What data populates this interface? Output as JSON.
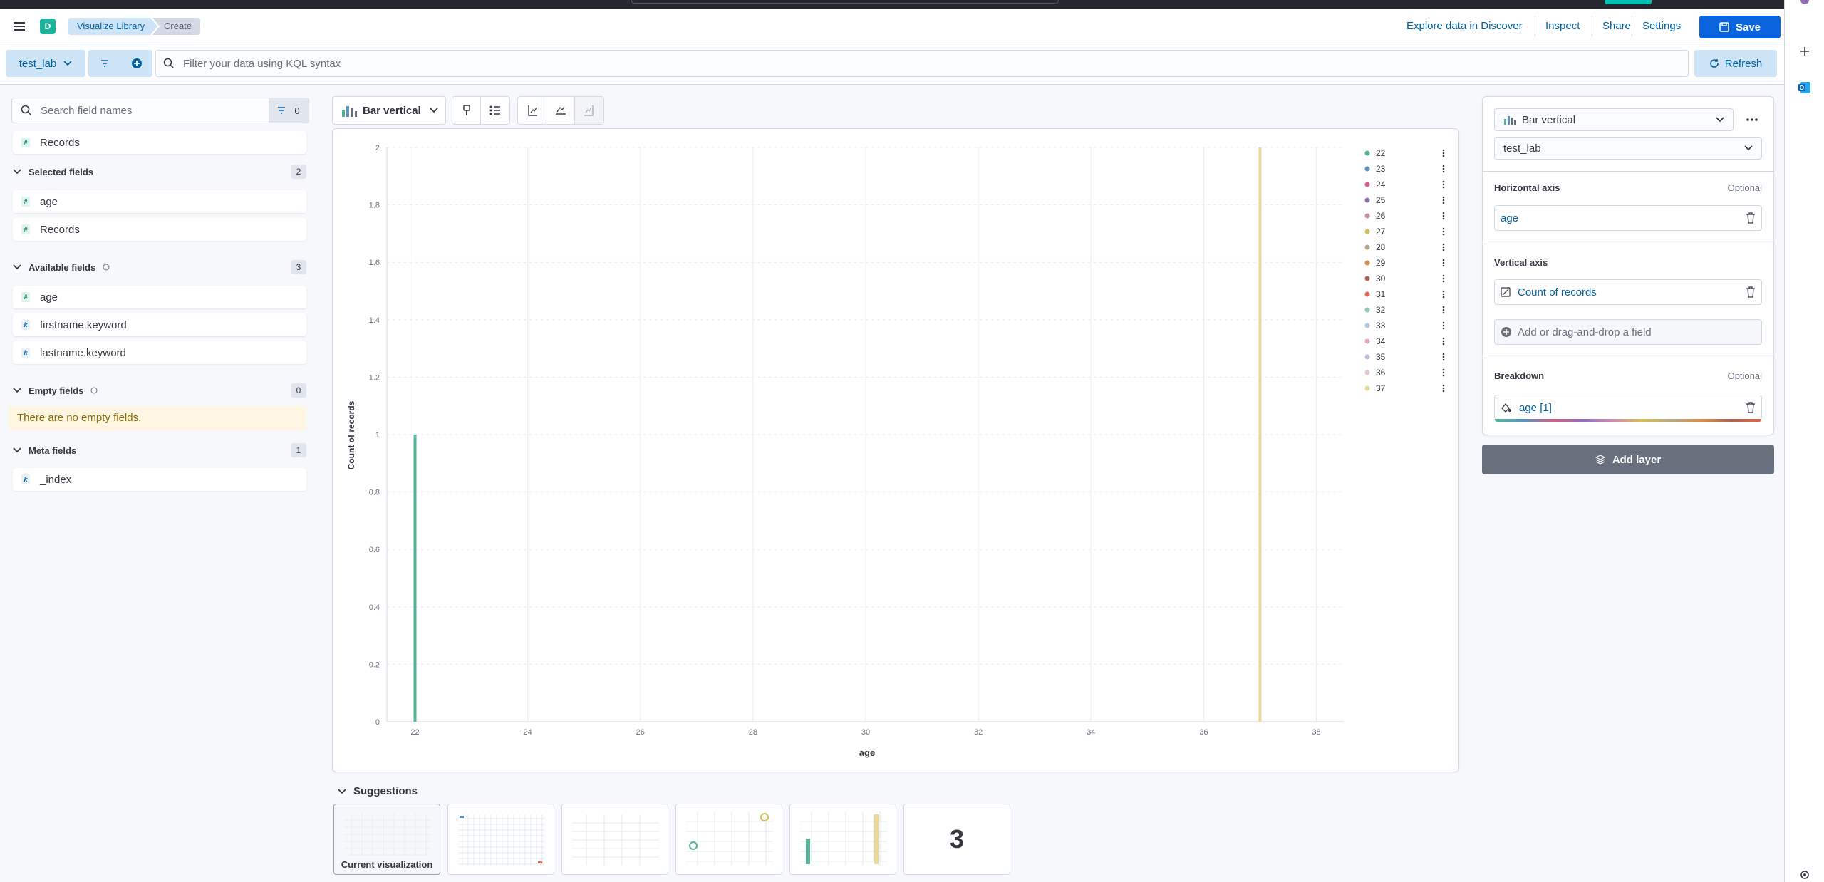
{
  "colors": {
    "accent": "#0b64dd",
    "link": "#0061a6",
    "badge": "#1bb39c",
    "bar_22": "#54b399",
    "bar_37": "#ecd998"
  },
  "header": {
    "space_initial": "D",
    "breadcrumbs": [
      "Visualize Library",
      "Create"
    ],
    "links": [
      "Explore data in Discover",
      "Inspect",
      "Share",
      "Settings"
    ],
    "save_label": "Save"
  },
  "query": {
    "data_view": "test_lab",
    "placeholder": "Filter your data using KQL syntax",
    "refresh_label": "Refresh"
  },
  "field_list": {
    "search_placeholder": "Search field names",
    "filter_count": "0",
    "records_item": "Records",
    "sections": [
      {
        "title": "Selected fields",
        "count": "2",
        "items": [
          {
            "name": "age",
            "type": "number"
          },
          {
            "name": "Records",
            "type": "number"
          }
        ]
      },
      {
        "title": "Available fields",
        "count": "3",
        "items": [
          {
            "name": "age",
            "type": "number"
          },
          {
            "name": "firstname.keyword",
            "type": "keyword"
          },
          {
            "name": "lastname.keyword",
            "type": "keyword"
          }
        ]
      },
      {
        "title": "Empty fields",
        "count": "0",
        "empty_message": "There are no empty fields."
      },
      {
        "title": "Meta fields",
        "count": "1",
        "items": [
          {
            "name": "_index",
            "type": "keyword"
          }
        ]
      }
    ]
  },
  "toolbar": {
    "chart_type": "Bar vertical"
  },
  "chart_data": {
    "type": "bar",
    "xlabel": "age",
    "ylabel": "Count of records",
    "xlim": [
      21.5,
      38.5
    ],
    "ylim": [
      0,
      2
    ],
    "x_ticks": [
      "22",
      "24",
      "26",
      "28",
      "30",
      "32",
      "34",
      "36",
      "38"
    ],
    "y_ticks": [
      "0",
      "0.2",
      "0.4",
      "0.6",
      "0.8",
      "1",
      "1.2",
      "1.4",
      "1.6",
      "1.8",
      "2"
    ],
    "grid": true,
    "legend_position": "right",
    "series": [
      {
        "name": "22",
        "color": "#54b399",
        "x": 22,
        "y": 1
      },
      {
        "name": "23",
        "color": "#6092c0",
        "x": 23,
        "y": 0
      },
      {
        "name": "24",
        "color": "#d36086",
        "x": 24,
        "y": 0
      },
      {
        "name": "25",
        "color": "#9170b8",
        "x": 25,
        "y": 0
      },
      {
        "name": "26",
        "color": "#ca8eae",
        "x": 26,
        "y": 0
      },
      {
        "name": "27",
        "color": "#d6bf57",
        "x": 27,
        "y": 0
      },
      {
        "name": "28",
        "color": "#b9a888",
        "x": 28,
        "y": 0
      },
      {
        "name": "29",
        "color": "#da8b45",
        "x": 29,
        "y": 0
      },
      {
        "name": "30",
        "color": "#aa6556",
        "x": 30,
        "y": 0
      },
      {
        "name": "31",
        "color": "#e7664c",
        "x": 31,
        "y": 0
      },
      {
        "name": "32",
        "color": "#98c8b8",
        "x": 32,
        "y": 0
      },
      {
        "name": "33",
        "color": "#b0c9e0",
        "x": 33,
        "y": 0
      },
      {
        "name": "34",
        "color": "#e4a6c7",
        "x": 34,
        "y": 0
      },
      {
        "name": "35",
        "color": "#c9b8dc",
        "x": 35,
        "y": 0
      },
      {
        "name": "36",
        "color": "#e4c4d8",
        "x": 36,
        "y": 0
      },
      {
        "name": "37",
        "color": "#ecd998",
        "x": 37,
        "y": 2
      }
    ]
  },
  "config": {
    "chart_type": "Bar vertical",
    "data_view": "test_lab",
    "horizontal_axis": {
      "title": "Horizontal axis",
      "optional": "Optional",
      "field": "age"
    },
    "vertical_axis": {
      "title": "Vertical axis",
      "field": "Count of records",
      "add_field": "Add or drag-and-drop a field"
    },
    "breakdown": {
      "title": "Breakdown",
      "optional": "Optional",
      "field": "age [1]"
    },
    "add_layer_label": "Add layer"
  },
  "suggestions": {
    "title": "Suggestions",
    "current_label": "Current visualization",
    "metric_value": "3"
  }
}
